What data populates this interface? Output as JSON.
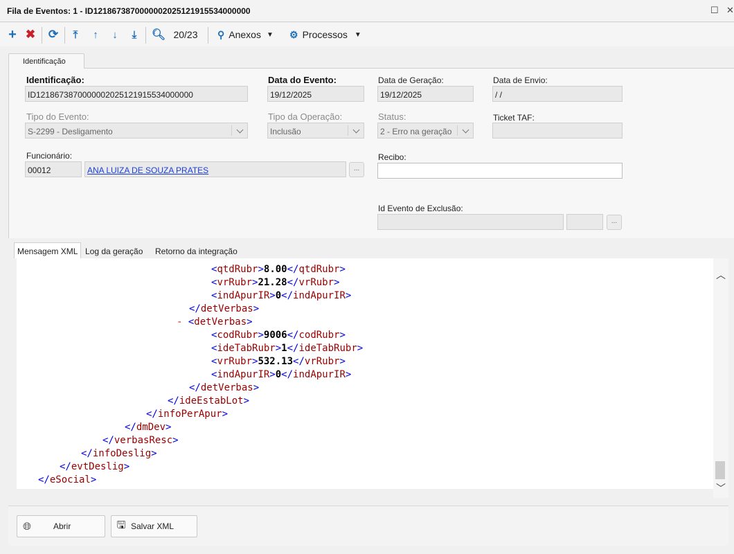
{
  "window": {
    "title": "Fila de Eventos: 1 - ID1218673870000002025121915534000000",
    "max_glyph": "☐",
    "close_glyph": "✕"
  },
  "toolbar": {
    "counter": "20/23",
    "anexos_label": "Anexos",
    "processos_label": "Processos"
  },
  "top_tab": {
    "label": "Identificação"
  },
  "form": {
    "identificacao": {
      "label": "Identificação:",
      "value": "ID1218673870000002025121915534000000"
    },
    "data_evento": {
      "label": "Data do Evento:",
      "value": "19/12/2025"
    },
    "data_geracao": {
      "label": "Data de Geração:",
      "value": "19/12/2025"
    },
    "data_envio": {
      "label": "Data de Envio:",
      "value": " / /"
    },
    "tipo_evento": {
      "label": "Tipo do Evento:",
      "value": "S-2299 - Desligamento"
    },
    "tipo_operacao": {
      "label": "Tipo da Operação:",
      "value": "Inclusão"
    },
    "status": {
      "label": "Status:",
      "value": "2 - Erro na geração"
    },
    "ticket_taf": {
      "label": "Ticket TAF:",
      "value": ""
    },
    "funcionario": {
      "label": "Funcionário:",
      "code": "00012",
      "name": "ANA LUIZA  DE SOUZA PRATES"
    },
    "recibo": {
      "label": "Recibo:",
      "value": ""
    },
    "id_exclusao": {
      "label": "Id Evento de Exclusão:",
      "value": ""
    },
    "dots": "..."
  },
  "bottom_tabs": [
    "Mensagem XML",
    "Log da geração",
    "Retorno da integração"
  ],
  "xml": {
    "lines": [
      {
        "o": "<",
        "n": "qtdRubr",
        "c": ">",
        "v": "8.00",
        "o2": "</",
        "n2": "qtdRubr",
        "c2": ">"
      },
      {
        "o": "<",
        "n": "vrRubr",
        "c": ">",
        "v": "21.28",
        "o2": "</",
        "n2": "vrRubr",
        "c2": ">"
      },
      {
        "o": "<",
        "n": "indApurIR",
        "c": ">",
        "v": "0",
        "o2": "</",
        "n2": "indApurIR",
        "c2": ">"
      },
      {
        "o": "</",
        "n": "detVerbas",
        "c": ">"
      },
      {
        "m": "-",
        "o": "<",
        "n": "detVerbas",
        "c": ">"
      },
      {
        "o": "<",
        "n": "codRubr",
        "c": ">",
        "v": "9006",
        "o2": "</",
        "n2": "codRubr",
        "c2": ">"
      },
      {
        "o": "<",
        "n": "ideTabRubr",
        "c": ">",
        "v": "1",
        "o2": "</",
        "n2": "ideTabRubr",
        "c2": ">"
      },
      {
        "o": "<",
        "n": "vrRubr",
        "c": ">",
        "v": "532.13",
        "o2": "</",
        "n2": "vrRubr",
        "c2": ">"
      },
      {
        "o": "<",
        "n": "indApurIR",
        "c": ">",
        "v": "0",
        "o2": "</",
        "n2": "indApurIR",
        "c2": ">"
      },
      {
        "o": "</",
        "n": "detVerbas",
        "c": ">"
      },
      {
        "o": "</",
        "n": "ideEstabLot",
        "c": ">"
      },
      {
        "o": "</",
        "n": "infoPerApur",
        "c": ">"
      },
      {
        "o": "</",
        "n": "dmDev",
        "c": ">"
      },
      {
        "o": "</",
        "n": "verbasResc",
        "c": ">"
      },
      {
        "o": "</",
        "n": "infoDeslig",
        "c": ">"
      },
      {
        "o": "</",
        "n": "evtDeslig",
        "c": ">"
      },
      {
        "o": "</",
        "n": "eSocial",
        "c": ">"
      }
    ]
  },
  "footer": {
    "abrir_label": "Abrir",
    "salvar_label": "Salvar XML"
  },
  "colors": {
    "accent_blue": "#1f6fb8",
    "delete_red": "#c8202a",
    "xml_tag": "#0000e6",
    "xml_name": "#990000"
  }
}
